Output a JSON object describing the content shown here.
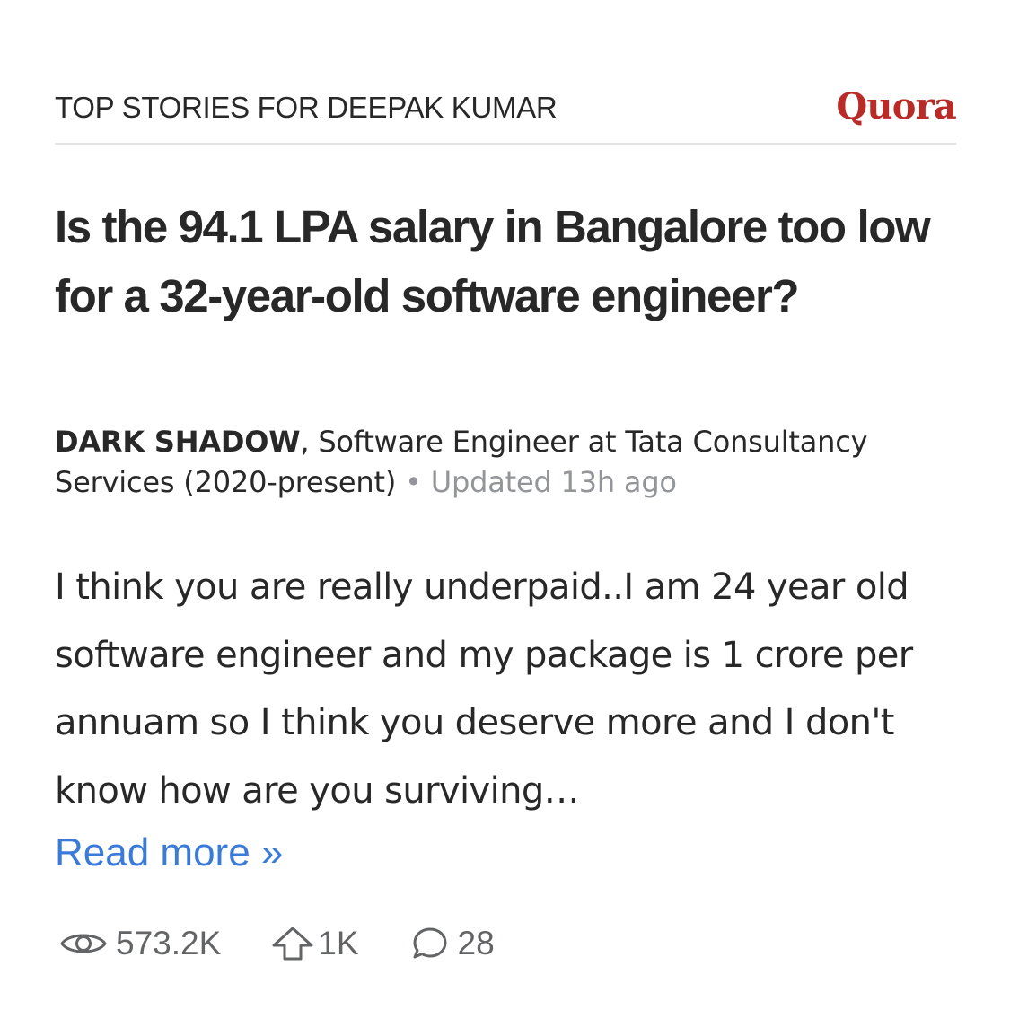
{
  "header": {
    "title": "TOP STORIES FOR DEEPAK KUMAR",
    "brand": "Quora"
  },
  "question": {
    "title": "Is the 94.1 LPA salary in Bangalore too low for a 32-year-old software engineer?"
  },
  "author": {
    "name": "DARK SHADOW",
    "credential": ", Software Engineer at Tata Consultancy Services (2020-present)",
    "separator": "•",
    "updated": "Updated 13h ago"
  },
  "answer": {
    "text": "I think you are really underpaid..I am 24 year old software engineer and my package is 1 crore per annuam so I think you deserve more and I don't know how are you surviving…",
    "read_more": "Read more »"
  },
  "stats": {
    "views": "573.2K",
    "upvotes": "1K",
    "comments": "28",
    "icons": [
      "eye-icon",
      "upvote-arrow-icon",
      "comment-bubble-icon"
    ]
  },
  "colors": {
    "brand": "#b92b27",
    "link": "#3b7bd8",
    "text": "#282829",
    "muted": "#939598"
  }
}
